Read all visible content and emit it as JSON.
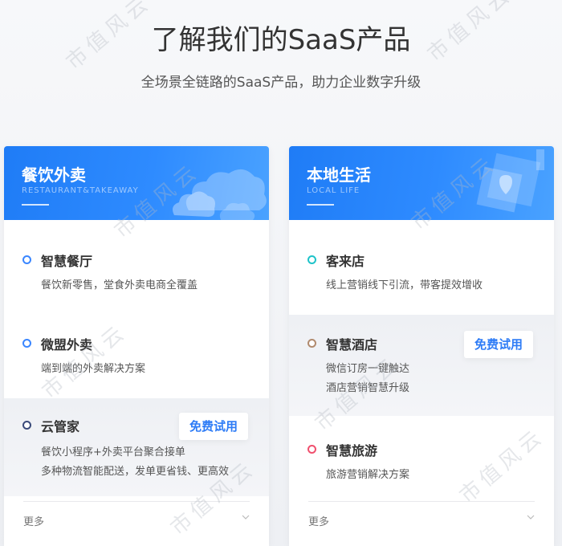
{
  "hero": {
    "title": "了解我们的SaaS产品",
    "subtitle": "全场景全链路的SaaS产品，助力企业数字升级"
  },
  "cards": [
    {
      "title": "餐饮外卖",
      "subtitle": "RESTAURANT&TAKEAWAY",
      "items": [
        {
          "title": "智慧餐厅",
          "desc": [
            "餐饮新零售，堂食外卖电商全覆盖"
          ],
          "dot_color": "#3a86ff"
        },
        {
          "title": "微盟外卖",
          "desc": [
            "端到端的外卖解决方案"
          ],
          "dot_color": "#3a86ff"
        },
        {
          "title": "云管家",
          "desc": [
            "餐饮小程序+外卖平台聚合接单",
            "多种物流智能配送，发单更省钱、更高效"
          ],
          "dot_color": "#3a4a7a",
          "button": "免费试用"
        }
      ],
      "more": "更多"
    },
    {
      "title": "本地生活",
      "subtitle": "LOCAL LIFE",
      "items": [
        {
          "title": "客来店",
          "desc": [
            "线上营销线下引流，带客提效增收"
          ],
          "dot_color": "#1ec3c9"
        },
        {
          "title": "智慧酒店",
          "desc": [
            "微信订房一键触达",
            "酒店营销智慧升级"
          ],
          "dot_color": "#b08a6e",
          "button": "免费试用"
        },
        {
          "title": "智慧旅游",
          "desc": [
            "旅游营销解决方案"
          ],
          "dot_color": "#f0506e"
        }
      ],
      "more": "更多"
    }
  ],
  "watermark": "市值风云",
  "colors": {
    "accent": "#2e7cf6",
    "header_gradient_start": "#1f7cf6",
    "header_gradient_end": "#4aa2ff"
  }
}
